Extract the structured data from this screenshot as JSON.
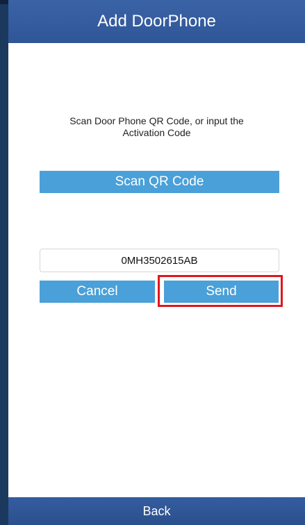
{
  "header": {
    "title": "Add DoorPhone"
  },
  "main": {
    "instructions_line1": "Scan Door Phone QR Code, or input the",
    "instructions_line2": "Activation Code",
    "scan_button_label": "Scan QR Code",
    "activation_code_value": "0MH3502615AB",
    "cancel_label": "Cancel",
    "send_label": "Send"
  },
  "footer": {
    "back_label": "Back"
  },
  "colors": {
    "header_bg": "#2f5697",
    "button_bg": "#4aa0d8",
    "highlight": "#e0161c",
    "side_bg": "#1c3b60"
  }
}
